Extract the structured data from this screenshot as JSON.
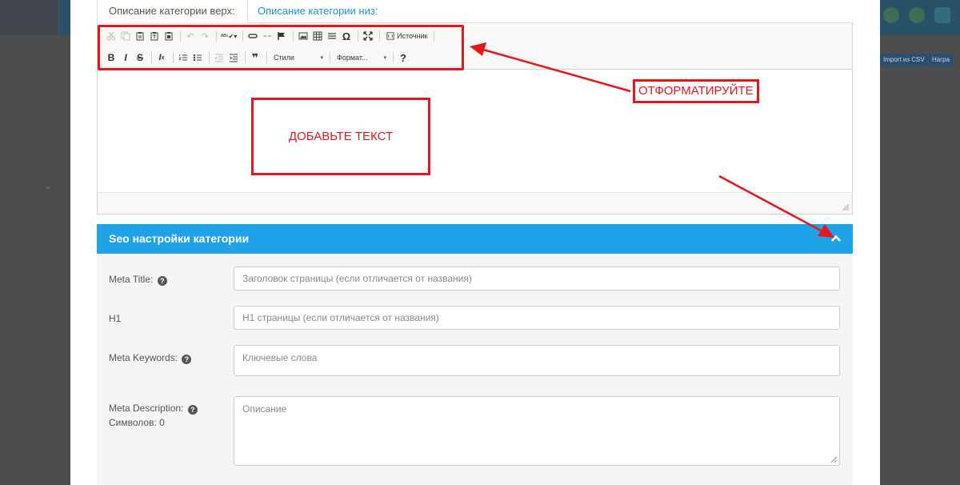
{
  "background": {
    "buttons": [
      "Import из CSV",
      "Награ"
    ]
  },
  "tabs": [
    {
      "label": "Описание категории верх:",
      "active": true
    },
    {
      "label": "Описание категории низ:",
      "active": false
    }
  ],
  "editor": {
    "toolbar_row1": [
      "cut-icon",
      "copy-icon",
      "paste-icon",
      "paste-text-icon",
      "paste-word-icon",
      "undo-icon",
      "redo-icon",
      "spellcheck-icon",
      "link-icon",
      "unlink-icon",
      "anchor-icon",
      "image-icon",
      "table-icon",
      "horizontal-rule-icon",
      "special-char-icon",
      "maximize-icon",
      "source-icon"
    ],
    "source_label": "Источник",
    "toolbar_row2": [
      "bold-icon",
      "italic-icon",
      "strike-icon",
      "remove-format-icon",
      "numbered-list-icon",
      "bulleted-list-icon",
      "outdent-icon",
      "indent-icon",
      "blockquote-icon"
    ],
    "bold_glyph": "B",
    "italic_glyph": "I",
    "strike_glyph": "S",
    "styles_label": "Стили",
    "format_label": "Формат...",
    "help_glyph": "?"
  },
  "annotations": {
    "format_label": "ОТФОРМАТИРУЙТЕ",
    "add_text_label": "ДОБАВЬТЕ ТЕКСТ",
    "color": "#e8151a"
  },
  "seo": {
    "title": "Seo настройки категории",
    "header_color": "#1ea2e8",
    "fields": {
      "meta_title": {
        "label": "Meta Title:",
        "placeholder": "Заголовок страницы (если отличается от названия)"
      },
      "h1": {
        "label": "H1",
        "placeholder": "H1 страницы (если отличается от названия)"
      },
      "meta_keywords": {
        "label": "Meta Keywords:",
        "placeholder": "Ключевые слова"
      },
      "meta_description": {
        "label": "Meta Description:",
        "counter": "Символов: 0",
        "placeholder": "Описание"
      }
    }
  }
}
